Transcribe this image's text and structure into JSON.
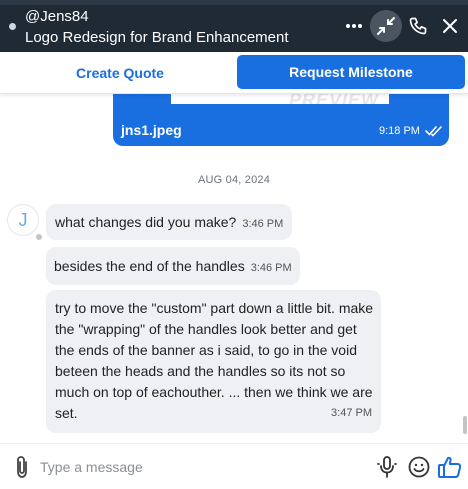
{
  "header": {
    "username": "@Jens84",
    "title": "Logo Redesign for Brand Enhancement",
    "icons": [
      "more-icon",
      "minimize-icon",
      "phone-icon",
      "close-icon"
    ]
  },
  "actions": {
    "create_quote": "Create Quote",
    "request_milestone": "Request Milestone"
  },
  "attachment": {
    "file_name": "jns1.jpeg",
    "time": "9:18 PM",
    "preview_watermark": "PREVIEW",
    "status_icon": "double-check-icon"
  },
  "date_separator": "AUG 04, 2024",
  "contact": {
    "avatar_initial": "J"
  },
  "messages": [
    {
      "text": "what changes did you make?",
      "time": "3:46 PM"
    },
    {
      "text": "besides the end of the handles",
      "time": "3:46 PM"
    },
    {
      "text": "try to move the \"custom\" part down a little bit. make the \"wrapping\" of the handles look better and get the ends of the banner as i said, to go in the void beteen the heads and the handles so its not so much on top of eachouther. ... then we think we are set.",
      "time": "3:47 PM"
    }
  ],
  "composer": {
    "placeholder": "Type a message",
    "value": "",
    "icons": [
      "paperclip-icon",
      "microphone-icon",
      "emoji-icon",
      "thumbs-up-icon"
    ]
  },
  "colors": {
    "header_bg": "#1f2a35",
    "accent": "#1a6fe0",
    "bubble_bg": "#eef0f3"
  }
}
